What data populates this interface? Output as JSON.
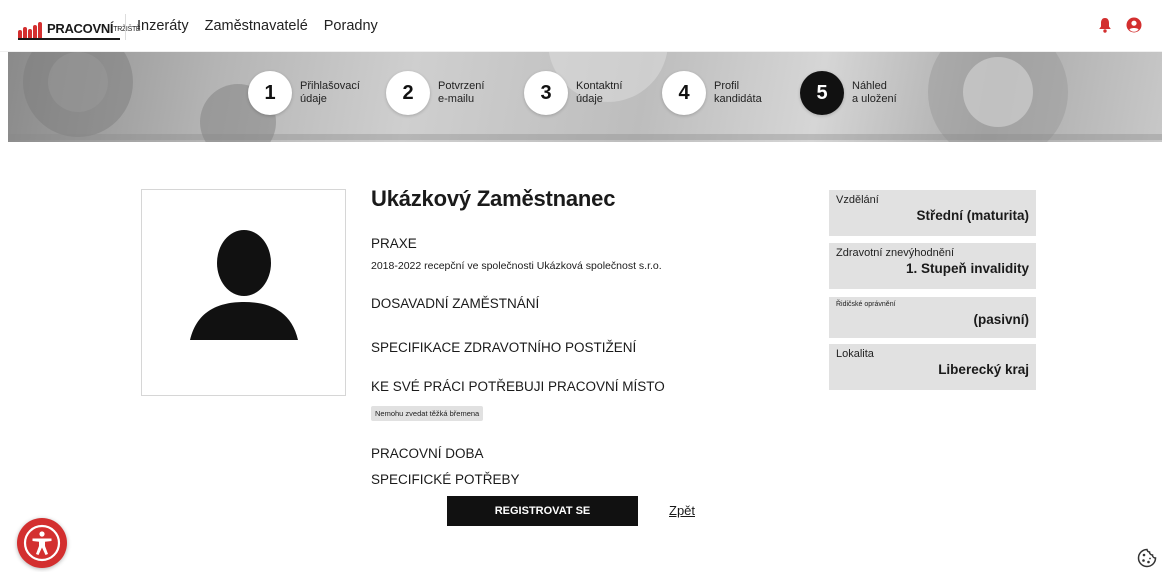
{
  "header": {
    "logo_text": "PRACOVNÍ",
    "logo_small": "TRŽIŠTĚ",
    "nav": [
      "Inzeráty",
      "Zaměstnavatelé",
      "Poradny"
    ],
    "icons": [
      "bell-icon",
      "user-circle-icon"
    ]
  },
  "steps": [
    {
      "num": "1",
      "line1": "Přihlašovací",
      "line2": "údaje",
      "active": false
    },
    {
      "num": "2",
      "line1": "Potvrzení",
      "line2": "e-mailu",
      "active": false
    },
    {
      "num": "3",
      "line1": "Kontaktní",
      "line2": "údaje",
      "active": false
    },
    {
      "num": "4",
      "line1": "Profil",
      "line2": "kandidáta",
      "active": false
    },
    {
      "num": "5",
      "line1": "Náhled",
      "line2": "a uložení",
      "active": true
    }
  ],
  "profile": {
    "name": "Ukázkový Zaměstnanec",
    "praxe_title": "PRAXE",
    "praxe_text": "2018-2022 recepční ve společnosti Ukázková společnost s.r.o.",
    "employment_title": "DOSAVADNÍ ZAMĚSTNÁNÍ",
    "health_title": "SPECIFIKACE ZDRAVOTNÍHO POSTIŽENÍ",
    "workplace_title": "KE SVÉ PRÁCI POTŘEBUJI PRACOVNÍ MÍSTO",
    "workplace_tag": "Nemohu zvedat těžká břemena",
    "hours_title": "PRACOVNÍ DOBA",
    "needs_title": "SPECIFICKÉ POTŘEBY"
  },
  "actions": {
    "register_label": "REGISTROVAT SE",
    "back_label": "Zpět"
  },
  "info": {
    "education_label": "Vzdělání",
    "education_value": "Střední (maturita)",
    "disability_label": "Zdravotní znevýhodnění",
    "disability_value": "1. Stupeň invalidity",
    "license_label": "Řidičské oprávnění",
    "license_value": "(pasivní)",
    "location_label": "Lokalita",
    "location_value": "Liberecký kraj"
  },
  "colors": {
    "accent": "#d32f2f",
    "dark": "#111111",
    "box": "#e1e1e1"
  }
}
